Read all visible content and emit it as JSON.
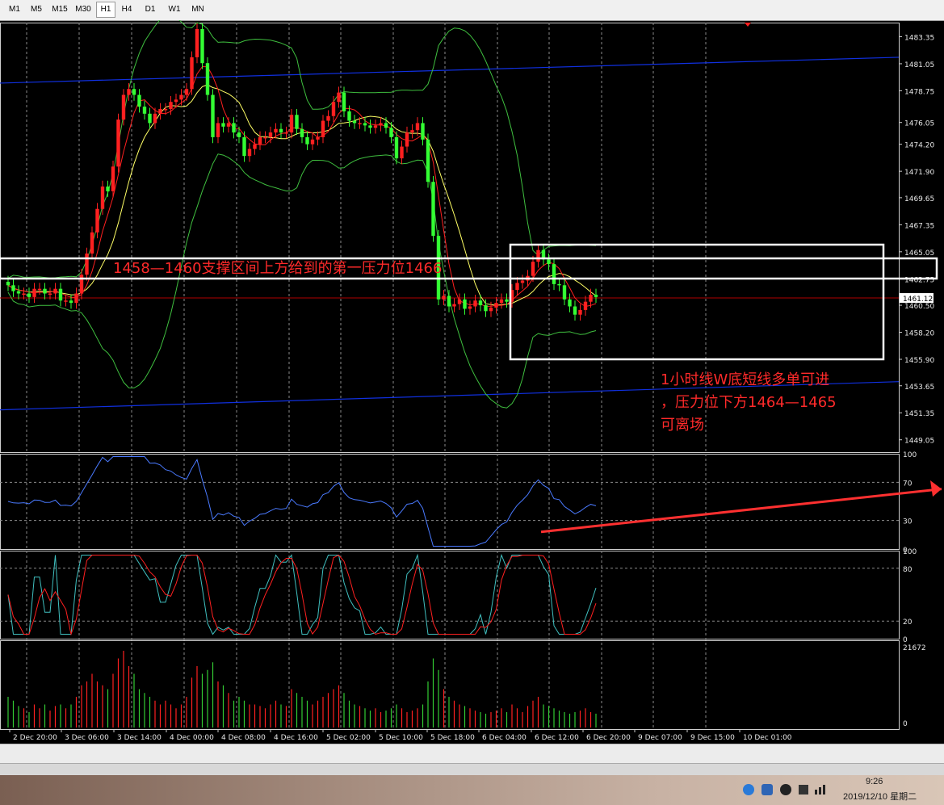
{
  "timeframes": [
    {
      "label": "M1"
    },
    {
      "label": "M5"
    },
    {
      "label": "M15"
    },
    {
      "label": "M30"
    },
    {
      "label": "H1",
      "active": true
    },
    {
      "label": "H4"
    },
    {
      "label": "D1"
    },
    {
      "label": "W1"
    },
    {
      "label": "MN"
    }
  ],
  "annotations": {
    "support_text": "1458—1460支撑区间上方给到的第一压力位1466",
    "note_line1": "1小时线W底短线多单可进",
    "note_line2": "，压力位下方1464—1465",
    "note_line3": "可离场"
  },
  "chart_data": {
    "type": "candlestick",
    "price_axis": [
      "1483.35",
      "1481.05",
      "1478.75",
      "1476.05",
      "1474.20",
      "1471.90",
      "1469.65",
      "1467.35",
      "1465.05",
      "1462.75",
      "1460.50",
      "1458.20",
      "1455.90",
      "1453.65",
      "1451.35",
      "1449.05"
    ],
    "current_price": "1461.12",
    "rsi_axis": [
      "100",
      "70",
      "30",
      "0"
    ],
    "stoch_axis": [
      "100",
      "80",
      "20",
      "0"
    ],
    "volume_axis": [
      "21672",
      "0"
    ],
    "time_labels": [
      "2 Dec 20:00",
      "3 Dec 06:00",
      "3 Dec 14:00",
      "4 Dec 00:00",
      "4 Dec 08:00",
      "4 Dec 16:00",
      "5 Dec 02:00",
      "5 Dec 10:00",
      "5 Dec 18:00",
      "6 Dec 04:00",
      "6 Dec 12:00",
      "6 Dec 20:00",
      "9 Dec 07:00",
      "9 Dec 15:00",
      "10 Dec 01:00"
    ],
    "closes": [
      1462.2,
      1461.7,
      1461.5,
      1461.5,
      1461.2,
      1461.9,
      1461.9,
      1461.5,
      1461.5,
      1461.9,
      1460.9,
      1460.9,
      1460.7,
      1461.5,
      1463.1,
      1464.9,
      1466.7,
      1468.7,
      1470.6,
      1470.2,
      1472.3,
      1476.3,
      1478.4,
      1478.9,
      1478.4,
      1477.4,
      1476.8,
      1476.0,
      1476.8,
      1477.2,
      1477.2,
      1477.8,
      1478.0,
      1478.4,
      1478.9,
      1481.6,
      1484.0,
      1481.1,
      1478.4,
      1474.8,
      1476.0,
      1475.7,
      1476.0,
      1475.2,
      1474.8,
      1473.2,
      1473.8,
      1474.2,
      1474.8,
      1474.8,
      1475.2,
      1475.5,
      1475.2,
      1475.2,
      1476.7,
      1475.5,
      1474.8,
      1474.2,
      1474.6,
      1474.8,
      1476.2,
      1476.6,
      1477.8,
      1478.6,
      1477.0,
      1476.2,
      1476.0,
      1476.0,
      1475.8,
      1475.6,
      1475.8,
      1476.0,
      1475.6,
      1474.8,
      1473.0,
      1474.0,
      1475.2,
      1475.4,
      1476.0,
      1474.6,
      1471.0,
      1466.4,
      1461.0,
      1461.3,
      1460.4,
      1460.6,
      1461.0,
      1460.2,
      1460.4,
      1460.9,
      1460.5,
      1460.0,
      1460.3,
      1460.7,
      1461.0,
      1460.8,
      1461.8,
      1462.4,
      1462.6,
      1463.0,
      1464.2,
      1465.2,
      1464.4,
      1464.0,
      1462.3,
      1462.2,
      1461.0,
      1460.4,
      1459.7,
      1460.1,
      1460.8,
      1461.4,
      1461.2
    ],
    "volumes": [
      0.4,
      0.35,
      0.28,
      0.25,
      0.2,
      0.3,
      0.25,
      0.3,
      0.22,
      0.28,
      0.3,
      0.25,
      0.3,
      0.4,
      0.55,
      0.6,
      0.7,
      0.6,
      0.55,
      0.5,
      0.7,
      0.9,
      1.0,
      0.8,
      0.7,
      0.5,
      0.45,
      0.4,
      0.35,
      0.3,
      0.35,
      0.3,
      0.25,
      0.3,
      0.4,
      0.65,
      0.8,
      0.7,
      0.75,
      0.85,
      0.6,
      0.55,
      0.45,
      0.35,
      0.4,
      0.35,
      0.3,
      0.3,
      0.28,
      0.25,
      0.3,
      0.35,
      0.3,
      0.28,
      0.5,
      0.45,
      0.4,
      0.35,
      0.3,
      0.35,
      0.4,
      0.45,
      0.5,
      0.55,
      0.45,
      0.35,
      0.3,
      0.28,
      0.25,
      0.22,
      0.25,
      0.2,
      0.22,
      0.25,
      0.3,
      0.25,
      0.2,
      0.22,
      0.25,
      0.3,
      0.6,
      0.9,
      0.75,
      0.5,
      0.4,
      0.35,
      0.3,
      0.28,
      0.25,
      0.22,
      0.2,
      0.18,
      0.2,
      0.22,
      0.25,
      0.2,
      0.3,
      0.25,
      0.2,
      0.28,
      0.35,
      0.4,
      0.3,
      0.28,
      0.25,
      0.22,
      0.2,
      0.18,
      0.2,
      0.22,
      0.25,
      0.2,
      0.18
    ]
  }
}
